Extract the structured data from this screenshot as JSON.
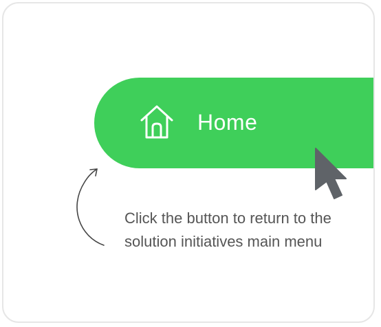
{
  "home_button": {
    "label": "Home",
    "icon": "home-icon",
    "color": "#3fcf5a"
  },
  "cursor": {
    "icon": "mouse-pointer-icon",
    "color": "#5f6368"
  },
  "hint": {
    "text": "Click the button to return to the solution initiatives main menu",
    "arrow_icon": "curved-arrow-icon"
  }
}
